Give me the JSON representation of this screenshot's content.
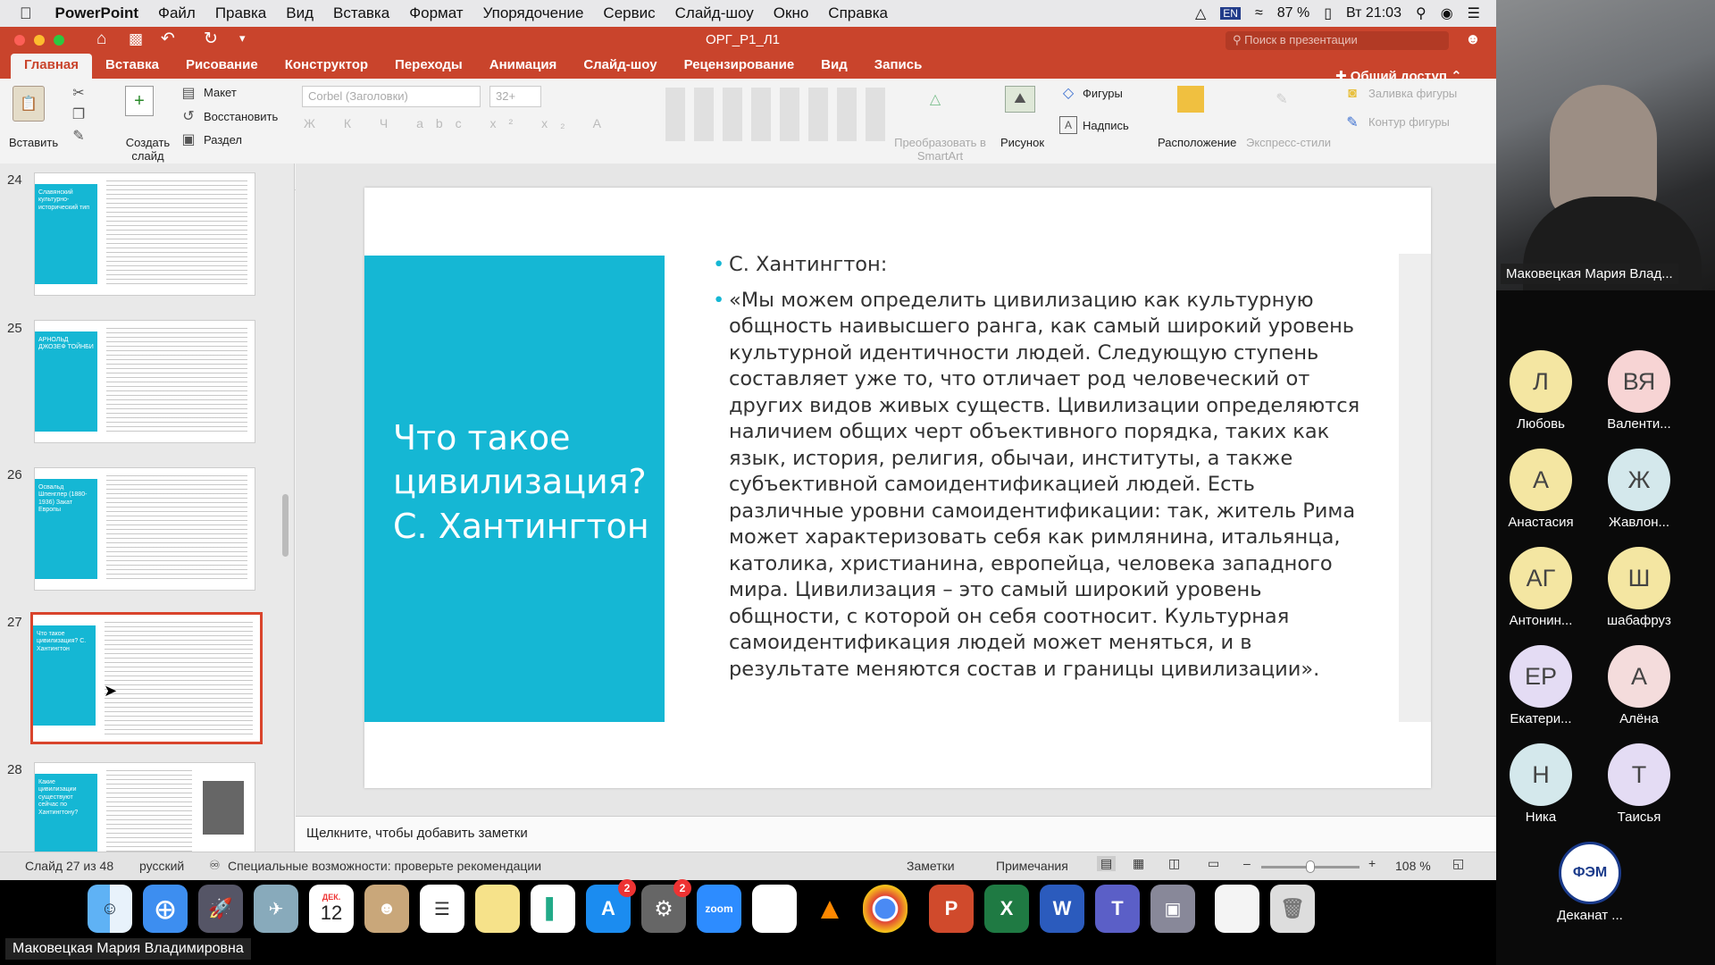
{
  "menubar": {
    "apple": "",
    "app": "PowerPoint",
    "items": [
      "Файл",
      "Правка",
      "Вид",
      "Вставка",
      "Формат",
      "Упорядочение",
      "Сервис",
      "Слайд-шоу",
      "Окно",
      "Справка"
    ],
    "battery": "87 %",
    "clock": "Вт 21:03"
  },
  "window": {
    "doc_title": "ОРГ_Р1_Л1",
    "search_placeholder": "Поиск в презентации",
    "ribbon_tabs": [
      "Главная",
      "Вставка",
      "Рисование",
      "Конструктор",
      "Переходы",
      "Анимация",
      "Слайд-шоу",
      "Рецензирование",
      "Вид",
      "Запись"
    ],
    "share": "Общий доступ",
    "ribbon": {
      "paste": "Вставить",
      "new_slide": "Создать слайд",
      "layout": "Макет",
      "reset": "Восстановить",
      "section": "Раздел",
      "font": "Corbel (Заголовки)",
      "font_size": "32+",
      "smartart": "Преобразовать в SmartArt",
      "picture": "Рисунок",
      "shapes": "Фигуры",
      "textbox": "Надпись",
      "arrange": "Расположение",
      "quick_styles": "Экспресс-стили",
      "fill": "Заливка фигуры",
      "outline": "Контур фигуры"
    }
  },
  "thumbnails": [
    {
      "num": "24",
      "text": "Славянский культурно-исторический тип"
    },
    {
      "num": "25",
      "text": "АРНОЛЬД ДЖОЗЕФ ТОЙНБИ"
    },
    {
      "num": "26",
      "text": "Освальд Шпенглер (1880-1936) Закат Европы"
    },
    {
      "num": "27",
      "text": "Что такое цивилизация? С. Хантингтон"
    },
    {
      "num": "28",
      "text": "Какие цивилизации существуют сейчас по Хантингтону?"
    }
  ],
  "slide": {
    "title": "Что такое цивилизация? С. Хантингтон",
    "bullet1": "С. Хантингтон:",
    "bullet2": "«Мы можем определить цивилизацию как культурную общность наивысшего ранга, как самый широкий уровень культурной идентичности людей. Следующую ступень составляет уже то, что отличает род человеческий от других видов живых существ. Цивилизации определяются наличием общих черт объективного порядка, таких как язык, история, религия, обычаи, институты, а также субъективной самоидентификацией людей. Есть различные уровни самоидентификации: так, житель Рима может характеризовать себя как римлянина, итальянца, католика, христианина, европейца, человека западного мира. Цивилизация – это самый широкий уровень общности, с которой он себя соотносит. Культурная самоидентификация людей может меняться, и в результате меняются состав и границы цивилизации».",
    "accent": "#15b7d4"
  },
  "notes_placeholder": "Щелкните, чтобы добавить заметки",
  "status": {
    "slide_count": "Слайд 27 из 48",
    "language": "русский",
    "accessibility": "Специальные возможности: проверьте рекомендации",
    "notes": "Заметки",
    "comments": "Примечания",
    "zoom": "108 %"
  },
  "dock": {
    "calendar_month": "ДЕК.",
    "calendar_day": "12",
    "zoom_label": "zoom",
    "badge_appstore": "2",
    "badge_settings": "2"
  },
  "presenter_name": "Маковецкая Мария Владимировна",
  "zoom_panel": {
    "camera_name": "Маковецкая Мария Влад...",
    "participants": [
      {
        "initials": "Л",
        "name": "Любовь"
      },
      {
        "initials": "ВЯ",
        "name": "Валенти..."
      },
      {
        "initials": "А",
        "name": "Анастасия"
      },
      {
        "initials": "Ж",
        "name": "Жавлон..."
      },
      {
        "initials": "АГ",
        "name": "Антонин..."
      },
      {
        "initials": "Ш",
        "name": "шабафруз"
      },
      {
        "initials": "ЕР",
        "name": "Екатери..."
      },
      {
        "initials": "А",
        "name": "Алёна"
      },
      {
        "initials": "Н",
        "name": "Ника"
      },
      {
        "initials": "Т",
        "name": "Таисья"
      },
      {
        "initials": "ФЭМ",
        "name": "Деканат ..."
      }
    ]
  }
}
